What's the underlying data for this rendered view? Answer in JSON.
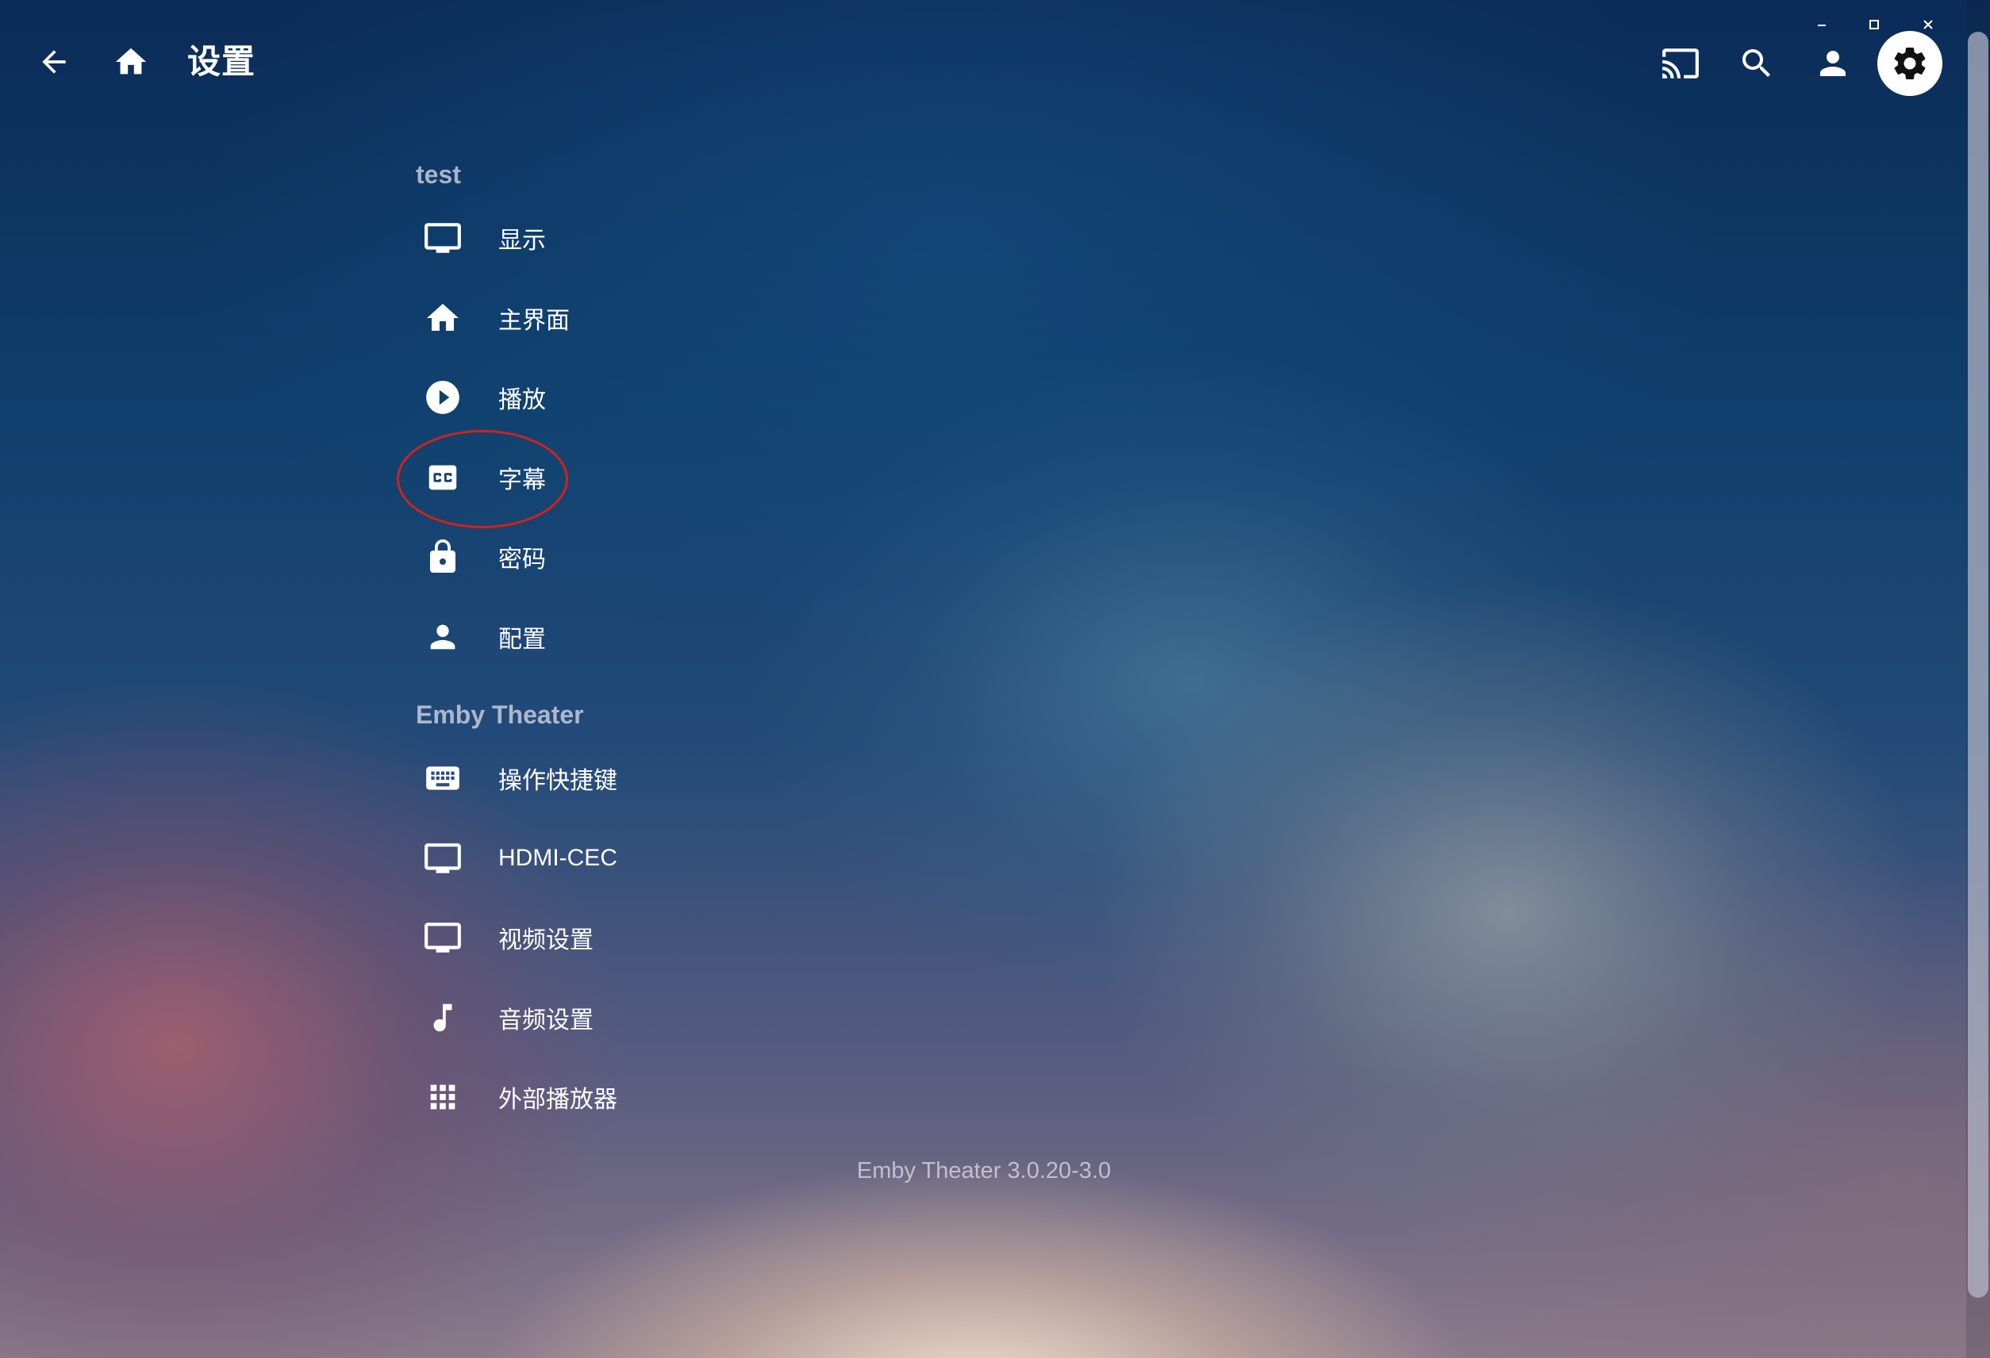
{
  "header": {
    "title": "设置"
  },
  "sections": [
    {
      "title": "test",
      "items": [
        {
          "label": "显示",
          "icon": "monitor-icon"
        },
        {
          "label": "主界面",
          "icon": "home-icon"
        },
        {
          "label": "播放",
          "icon": "play-circle-icon"
        },
        {
          "label": "字幕",
          "icon": "closed-caption-icon"
        },
        {
          "label": "密码",
          "icon": "lock-icon"
        },
        {
          "label": "配置",
          "icon": "person-icon"
        }
      ]
    },
    {
      "title": "Emby Theater",
      "items": [
        {
          "label": "操作快捷键",
          "icon": "keyboard-icon"
        },
        {
          "label": "HDMI-CEC",
          "icon": "monitor-icon"
        },
        {
          "label": "视频设置",
          "icon": "monitor-icon"
        },
        {
          "label": "音频设置",
          "icon": "music-note-icon"
        },
        {
          "label": "外部播放器",
          "icon": "apps-grid-icon"
        }
      ]
    }
  ],
  "footer": {
    "version": "Emby Theater 3.0.20-3.0"
  },
  "colors": {
    "highlight_circle": "#d3211b",
    "settings_button_bg": "#ffffff"
  }
}
